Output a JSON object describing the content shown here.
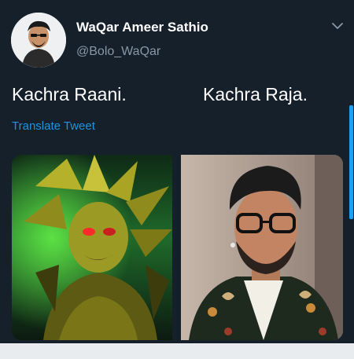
{
  "tweet": {
    "display_name": "WaQar Ameer Sathio",
    "handle": "@Bolo_WaQar",
    "text_left": "Kachra Raani.",
    "text_right": "Kachra Raja.",
    "translate_label": "Translate Tweet"
  },
  "icons": {
    "menu": "chevron-down-icon"
  },
  "colors": {
    "background": "#15202b",
    "link": "#1b95e0",
    "secondary_text": "#8899a6",
    "accent_scrollbar": "#1da1f2"
  }
}
